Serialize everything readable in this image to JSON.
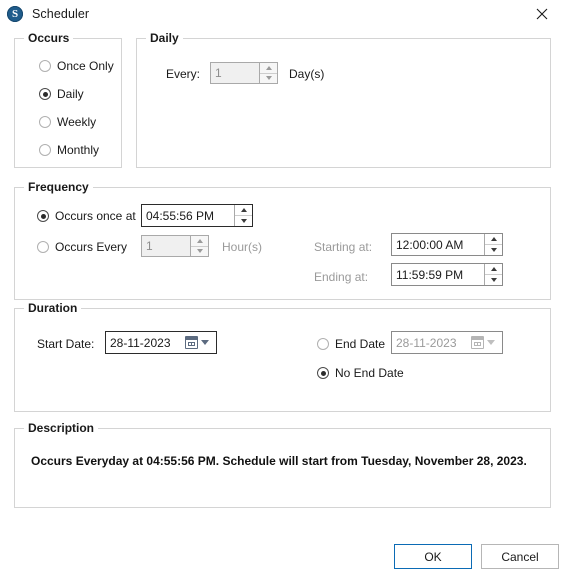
{
  "window": {
    "title": "Scheduler",
    "icon": "scheduler-app-icon",
    "close_icon": "close-icon",
    "accent_color": "#0b6bb5",
    "background": "#ffffff"
  },
  "occurs_group": {
    "legend": "Occurs",
    "options": [
      {
        "label": "Once Only",
        "selected": false
      },
      {
        "label": "Daily",
        "selected": true
      },
      {
        "label": "Weekly",
        "selected": false
      },
      {
        "label": "Monthly",
        "selected": false
      }
    ]
  },
  "daily_group": {
    "legend": "Daily",
    "every_label": "Every:",
    "every_value": "1",
    "unit_label": "Day(s)",
    "enabled": false
  },
  "frequency_group": {
    "legend": "Frequency",
    "once": {
      "radio_label": "Occurs once at",
      "selected": true,
      "time_value": "04:55:56 PM",
      "enabled": true
    },
    "every": {
      "radio_label": "Occurs Every",
      "selected": false,
      "interval_value": "1",
      "unit_label": "Hour(s)",
      "enabled": false
    },
    "starting_at": {
      "label": "Starting at:",
      "value": "12:00:00 AM",
      "enabled": false
    },
    "ending_at": {
      "label": "Ending at:",
      "value": "11:59:59 PM",
      "enabled": false
    }
  },
  "duration_group": {
    "legend": "Duration",
    "start_date": {
      "label": "Start Date:",
      "value": "28-11-2023",
      "enabled": true,
      "icon": "calendar-icon",
      "dropdown_icon": "chevron-down-icon"
    },
    "end_date": {
      "radio_label": "End Date",
      "selected": false,
      "value": "28-11-2023",
      "enabled": false,
      "icon": "calendar-icon",
      "dropdown_icon": "chevron-down-icon"
    },
    "no_end_date": {
      "radio_label": "No End Date",
      "selected": true
    }
  },
  "description_group": {
    "legend": "Description",
    "text": "Occurs Everyday at 04:55:56 PM. Schedule will start from Tuesday, November 28, 2023."
  },
  "footer": {
    "ok_label": "OK",
    "cancel_label": "Cancel"
  }
}
